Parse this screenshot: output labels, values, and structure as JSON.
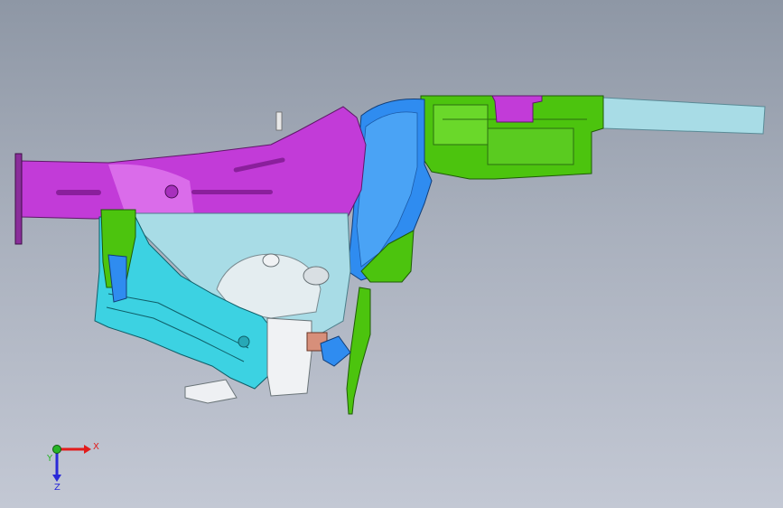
{
  "viewport": {
    "background_top": "#8e97a5",
    "background_bottom": "#c3c8d4"
  },
  "model": {
    "colors": {
      "magenta": "#c23bd8",
      "green": "#4cc40e",
      "cyan": "#3cd2e2",
      "blue": "#2f8cf0",
      "light_cyan": "#a8dce6",
      "white": "#f0f2f4",
      "salmon": "#d78f7a"
    }
  },
  "triad": {
    "x_label": "X",
    "y_label": "Y",
    "z_label": "Z",
    "x_color": "#e21b1b",
    "y_color": "#27b427",
    "z_color": "#2a2ad8"
  }
}
